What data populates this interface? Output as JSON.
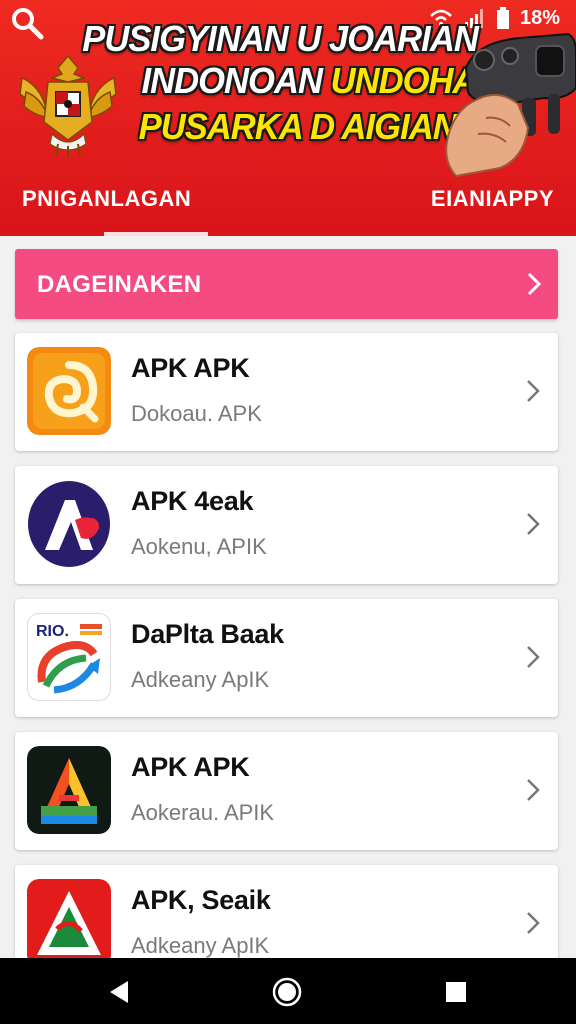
{
  "header": {
    "banner": {
      "line1": "PUSIGYINAN U JOARIAN",
      "line2_white": "INDONOAN",
      "line2_yellow": "UNDOHAN",
      "line3": "PUSARKA D AIGIAN"
    },
    "status": {
      "battery": "18%"
    },
    "tabs": [
      {
        "label": "PNIGANLAGAN"
      },
      {
        "label": "EIANIAPPY"
      }
    ],
    "colors": {
      "header_red": "#e21b1b",
      "banner_yellow": "#ffe600"
    }
  },
  "category_bar": {
    "label": "DAGEINAKEN",
    "color": "#f44b82"
  },
  "apps": [
    {
      "title": "APK APK",
      "subtitle": "Dokoau. APK",
      "icon": "orange-spiral-icon"
    },
    {
      "title": "APK 4eak",
      "subtitle": "Aokenu, APIK",
      "icon": "letter-a-red-icon"
    },
    {
      "title": "DaPlta Baak",
      "subtitle": "Adkeany ApIK",
      "icon": "colorful-swirl-icon"
    },
    {
      "title": "APK APK",
      "subtitle": "Aokerau. APIK",
      "icon": "rainbow-triangle-icon"
    },
    {
      "title": "APK, Seaik",
      "subtitle": "Adkeany ApIK",
      "icon": "red-triangle-icon"
    }
  ],
  "icon_text": {
    "app3_badge": "RIO."
  }
}
